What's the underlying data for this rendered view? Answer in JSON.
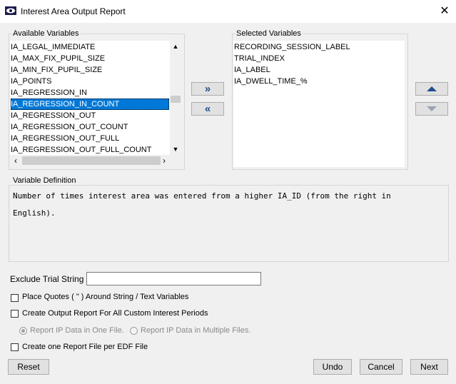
{
  "window": {
    "title": "Interest Area Output Report"
  },
  "available": {
    "label": "Available Variables",
    "items": [
      "IA_LEGAL_IMMEDIATE",
      "IA_MAX_FIX_PUPIL_SIZE",
      "IA_MIN_FIX_PUPIL_SIZE",
      "IA_POINTS",
      "IA_REGRESSION_IN",
      "IA_REGRESSION_IN_COUNT",
      "IA_REGRESSION_OUT",
      "IA_REGRESSION_OUT_COUNT",
      "IA_REGRESSION_OUT_FULL",
      "IA_REGRESSION_OUT_FULL_COUNT"
    ],
    "selected_item": "IA_REGRESSION_IN_COUNT"
  },
  "selected": {
    "label": "Selected Variables",
    "items": [
      "RECORDING_SESSION_LABEL",
      "TRIAL_INDEX",
      "IA_LABEL",
      "IA_DWELL_TIME_%"
    ]
  },
  "transfer": {
    "add_label": "»",
    "remove_label": "«"
  },
  "definition": {
    "label": "Variable Definition",
    "line1": "Number of times interest area was entered from a higher IA_ID (from the right in",
    "line2": "English)."
  },
  "options": {
    "exclude_label": "Exclude Trial String :",
    "exclude_value": "",
    "place_quotes": "Place Quotes ( \" ) Around String / Text Variables",
    "custom_periods": "Create Output Report For All Custom Interest Periods",
    "radio_one_file": "Report IP Data in One File.",
    "radio_multi_files": "Report IP Data in Multiple Files.",
    "per_edf": "Create one Report File per EDF File"
  },
  "buttons": {
    "reset": "Reset",
    "undo": "Undo",
    "cancel": "Cancel",
    "next": "Next"
  },
  "colors": {
    "selection": "#0078d7",
    "arrow": "#1f4e8c"
  }
}
